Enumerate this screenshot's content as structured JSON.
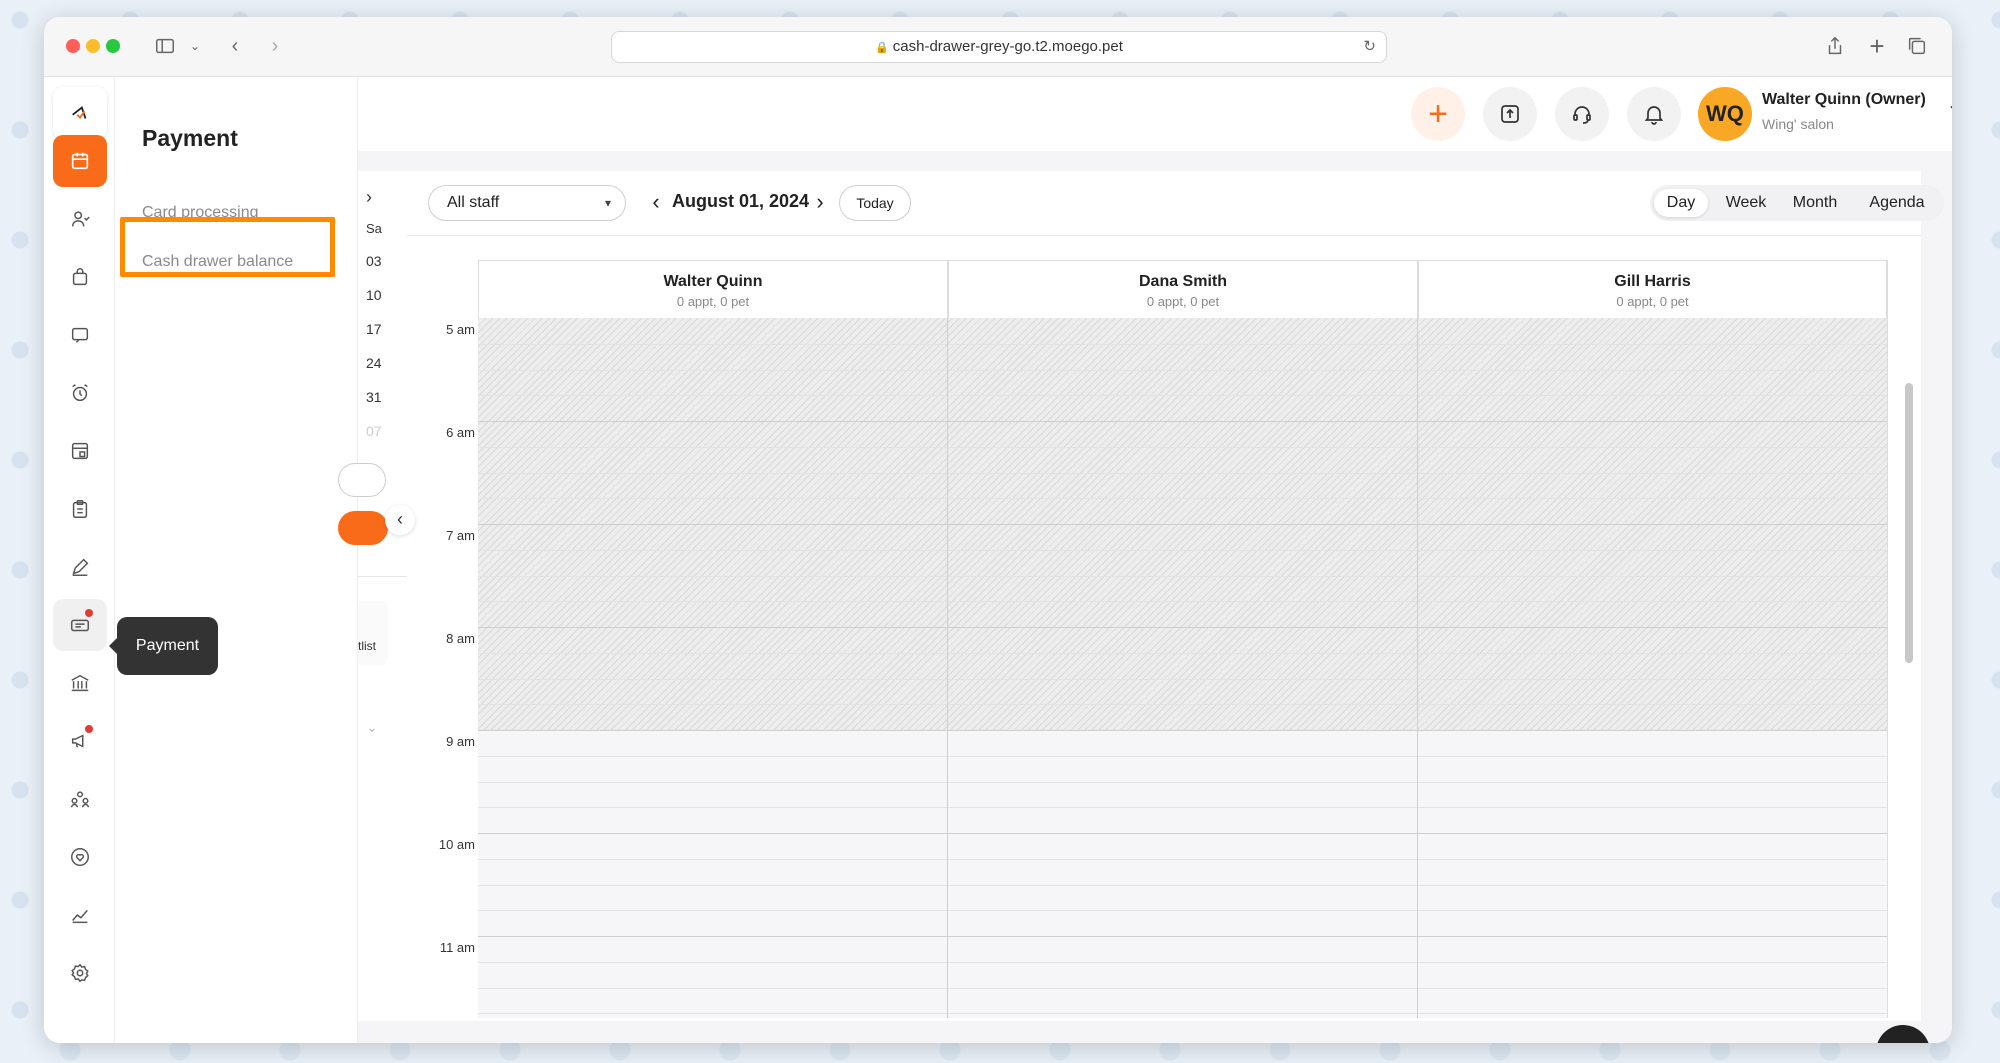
{
  "browser": {
    "url": "cash-drawer-grey-go.t2.moego.pet"
  },
  "subnav": {
    "title": "Payment",
    "items": [
      {
        "label": "Card processing"
      },
      {
        "label": "Cash drawer balance"
      }
    ]
  },
  "tooltip": {
    "label": "Payment"
  },
  "user": {
    "initials": "WQ",
    "name": "Walter Quinn (Owner)",
    "salon": "Wing' salon"
  },
  "mini_calendar": {
    "weekday": "Sa",
    "days": [
      "03",
      "10",
      "17",
      "24",
      "31",
      "07"
    ],
    "waitlist_partial": "tlist"
  },
  "calendar": {
    "staff_filter": "All staff",
    "date": "August 01, 2024",
    "today_label": "Today",
    "views": [
      "Day",
      "Week",
      "Month",
      "Agenda"
    ],
    "active_view": "Day",
    "columns": [
      {
        "name": "Walter Quinn",
        "sub": "0 appt, 0 pet"
      },
      {
        "name": "Dana Smith",
        "sub": "0 appt, 0 pet"
      },
      {
        "name": "Gill Harris",
        "sub": "0 appt, 0 pet"
      }
    ],
    "hours": [
      "5 am",
      "6 am",
      "7 am",
      "8 am",
      "9 am",
      "10 am",
      "11 am"
    ]
  },
  "colors": {
    "accent": "#f96b18",
    "highlight": "#ff8a00",
    "avatar": "#f9a825"
  }
}
